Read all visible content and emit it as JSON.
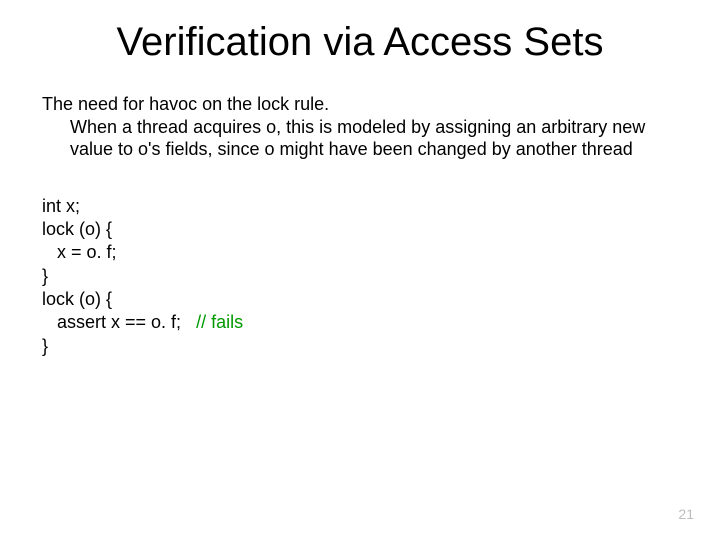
{
  "title": "Verification via Access Sets",
  "intro": {
    "line1": "The need for havoc on the lock rule.",
    "line2": "When a thread acquires o, this is modeled by assigning an arbitrary new value to o's fields, since o might have been changed by another thread"
  },
  "code": {
    "l1": "int x;",
    "l2": "lock (o) {",
    "l3": "   x = o. f;",
    "l4": "}",
    "l5": "lock (o) {",
    "l6a": "   assert x == o. f;   ",
    "l6b": "// fails",
    "l7": "}"
  },
  "page_number": "21"
}
